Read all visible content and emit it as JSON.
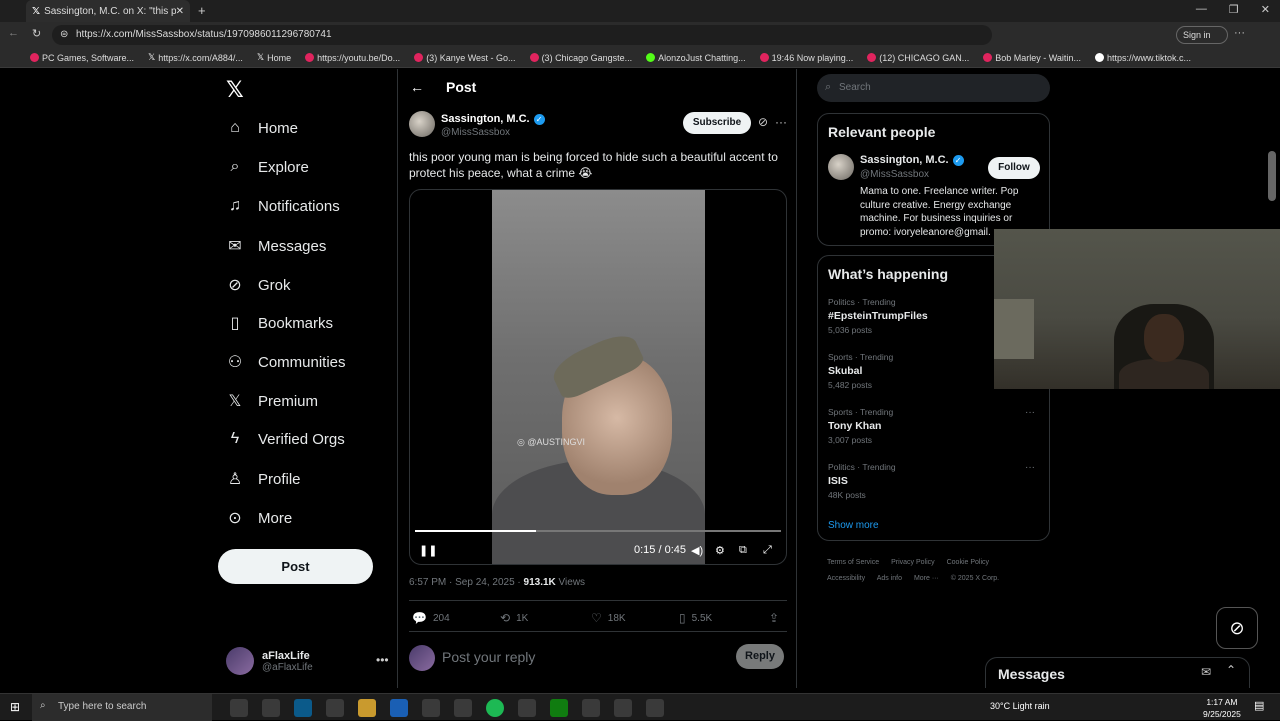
{
  "browser": {
    "tab_title": "Sassington, M.C. on X: \"this p",
    "url": "https://x.com/MissSassbox/status/1970986011296780741",
    "signin": "Sign in",
    "bookmarks": [
      "PC Games, Software...",
      "https://x.com/A884/...",
      "Home",
      "https://youtu.be/Do...",
      "(3) Kanye West - Go...",
      "(3) Chicago Gangste...",
      "AlonzoJust Chatting...",
      "19:46 Now playing...",
      "(12) CHICAGO GAN...",
      "Bob Marley - Waitin...",
      "https://www.tiktok.c..."
    ]
  },
  "nav": {
    "items": [
      "Home",
      "Explore",
      "Notifications",
      "Messages",
      "Grok",
      "Bookmarks",
      "Communities",
      "Premium",
      "Verified Orgs",
      "Profile",
      "More"
    ],
    "post_label": "Post",
    "account_name": "aFlaxLife",
    "account_handle": "@aFlaxLife"
  },
  "post": {
    "header": "Post",
    "author_name": "Sassington, M.C.",
    "author_handle": "@MissSassbox",
    "subscribe": "Subscribe",
    "text": "this poor young man is being forced to hide such a beautiful accent to protect his peace, what a crime 😭",
    "video_watermark": "@AUSTINGVI",
    "video_time": "0:15 / 0:45",
    "video_progress": 0.33,
    "timestamp": "6:57 PM · Sep 24, 2025 · ",
    "views_count": "913.1K",
    "views_label": " Views",
    "replies": "204",
    "reposts": "1K",
    "likes": "18K",
    "bookmarks": "5.5K",
    "reply_placeholder": "Post your reply",
    "reply_button": "Reply"
  },
  "sidebar": {
    "search_placeholder": "Search",
    "relevant_title": "Relevant people",
    "person_name": "Sassington, M.C.",
    "person_handle": "@MissSassbox",
    "follow": "Follow",
    "person_bio": "Mama to one. Freelance writer. Pop culture creative. Energy exchange machine. For business inquiries or promo: ivoryeleanore@gmail.",
    "happening_title": "What’s happening",
    "trends": [
      {
        "category": "Politics · Trending",
        "name": "#EpsteinTrumpFiles",
        "count": "5,036 posts"
      },
      {
        "category": "Sports · Trending",
        "name": "Skubal",
        "count": "5,482 posts"
      },
      {
        "category": "Sports · Trending",
        "name": "Tony Khan",
        "count": "3,007 posts"
      },
      {
        "category": "Politics · Trending",
        "name": "ISIS",
        "count": "48K posts"
      }
    ],
    "show_more": "Show more",
    "footer": [
      "Terms of Service",
      "Privacy Policy",
      "Cookie Policy",
      "Accessibility",
      "Ads info",
      "More ···",
      "© 2025 X Corp."
    ]
  },
  "messages_drawer": "Messages",
  "taskbar": {
    "search_placeholder": "Type here to search",
    "weather": "30°C  Light rain",
    "time": "1:17 AM",
    "date": "9/25/2025"
  }
}
